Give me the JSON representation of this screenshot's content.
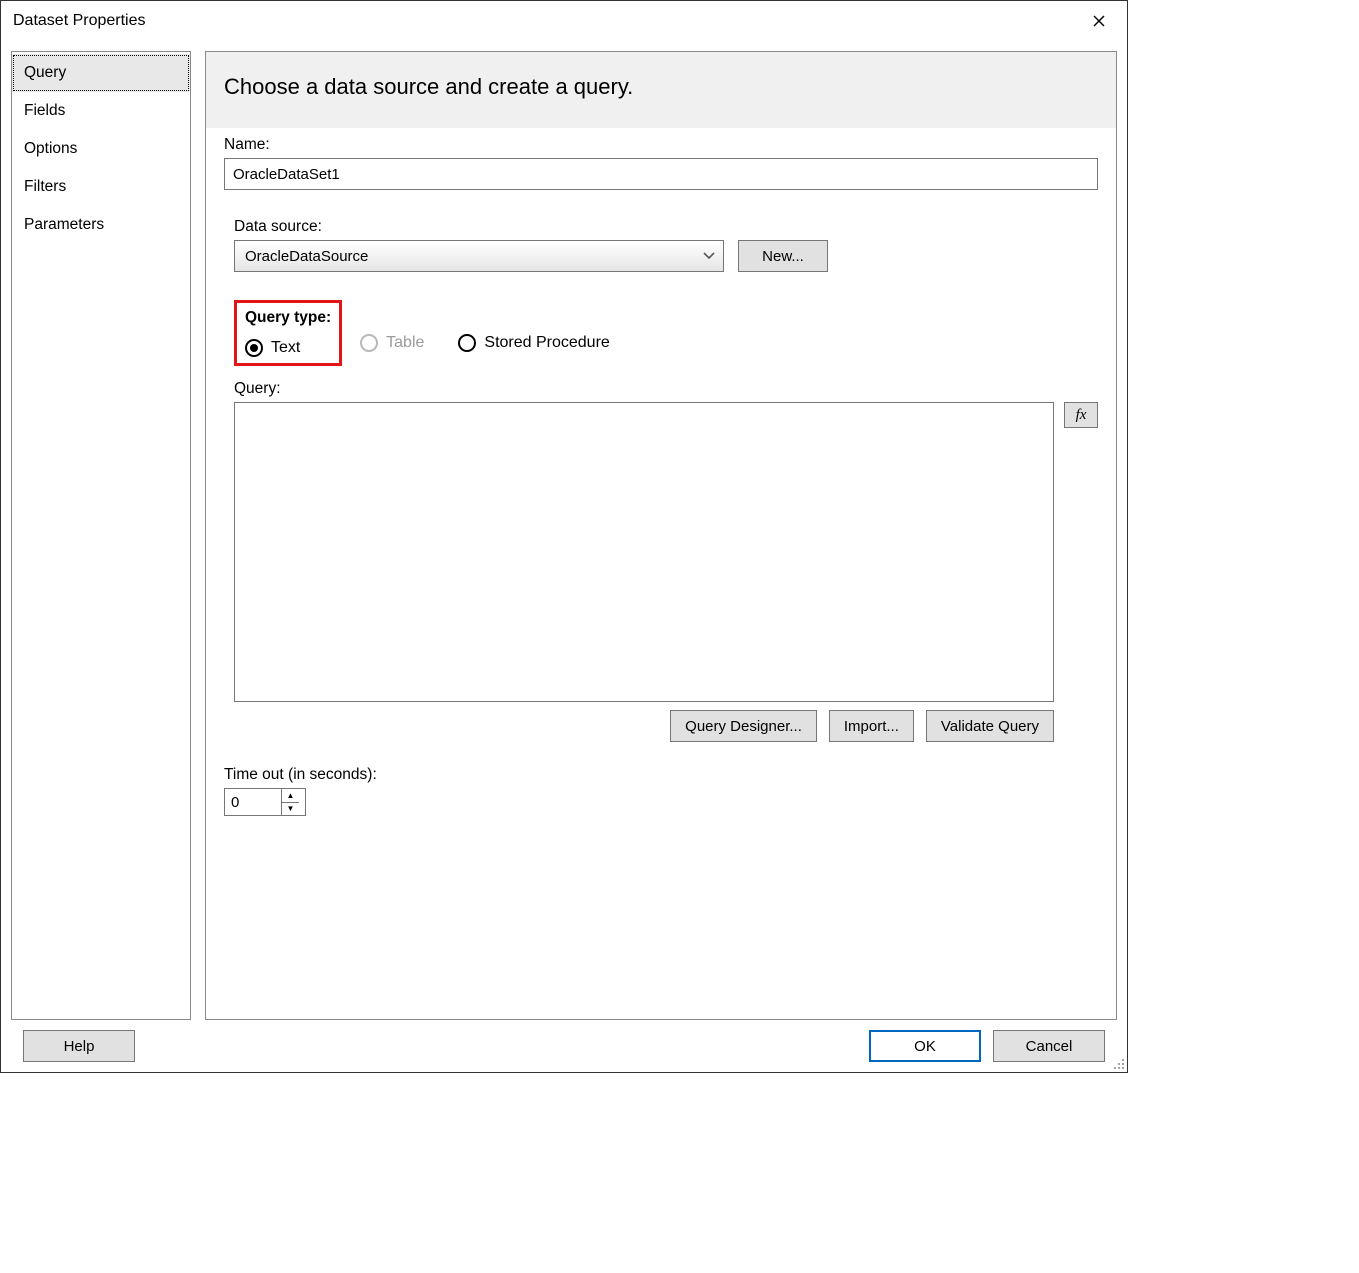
{
  "dialog": {
    "title": "Dataset Properties"
  },
  "nav": {
    "items": [
      "Query",
      "Fields",
      "Options",
      "Filters",
      "Parameters"
    ],
    "selected": "Query"
  },
  "main": {
    "heading": "Choose a data source and create a query.",
    "name_label": "Name:",
    "name_value": "OracleDataSet1",
    "data_source_label": "Data source:",
    "data_source_value": "OracleDataSource",
    "new_button": "New...",
    "query_type_label": "Query type:",
    "query_type_options": {
      "text": "Text",
      "table": "Table",
      "stored_procedure": "Stored Procedure"
    },
    "query_label": "Query:",
    "query_value": "",
    "fx_label": "fx",
    "query_designer_button": "Query Designer...",
    "import_button": "Import...",
    "validate_query_button": "Validate Query",
    "timeout_label": "Time out (in seconds):",
    "timeout_value": "0"
  },
  "footer": {
    "help": "Help",
    "ok": "OK",
    "cancel": "Cancel"
  }
}
